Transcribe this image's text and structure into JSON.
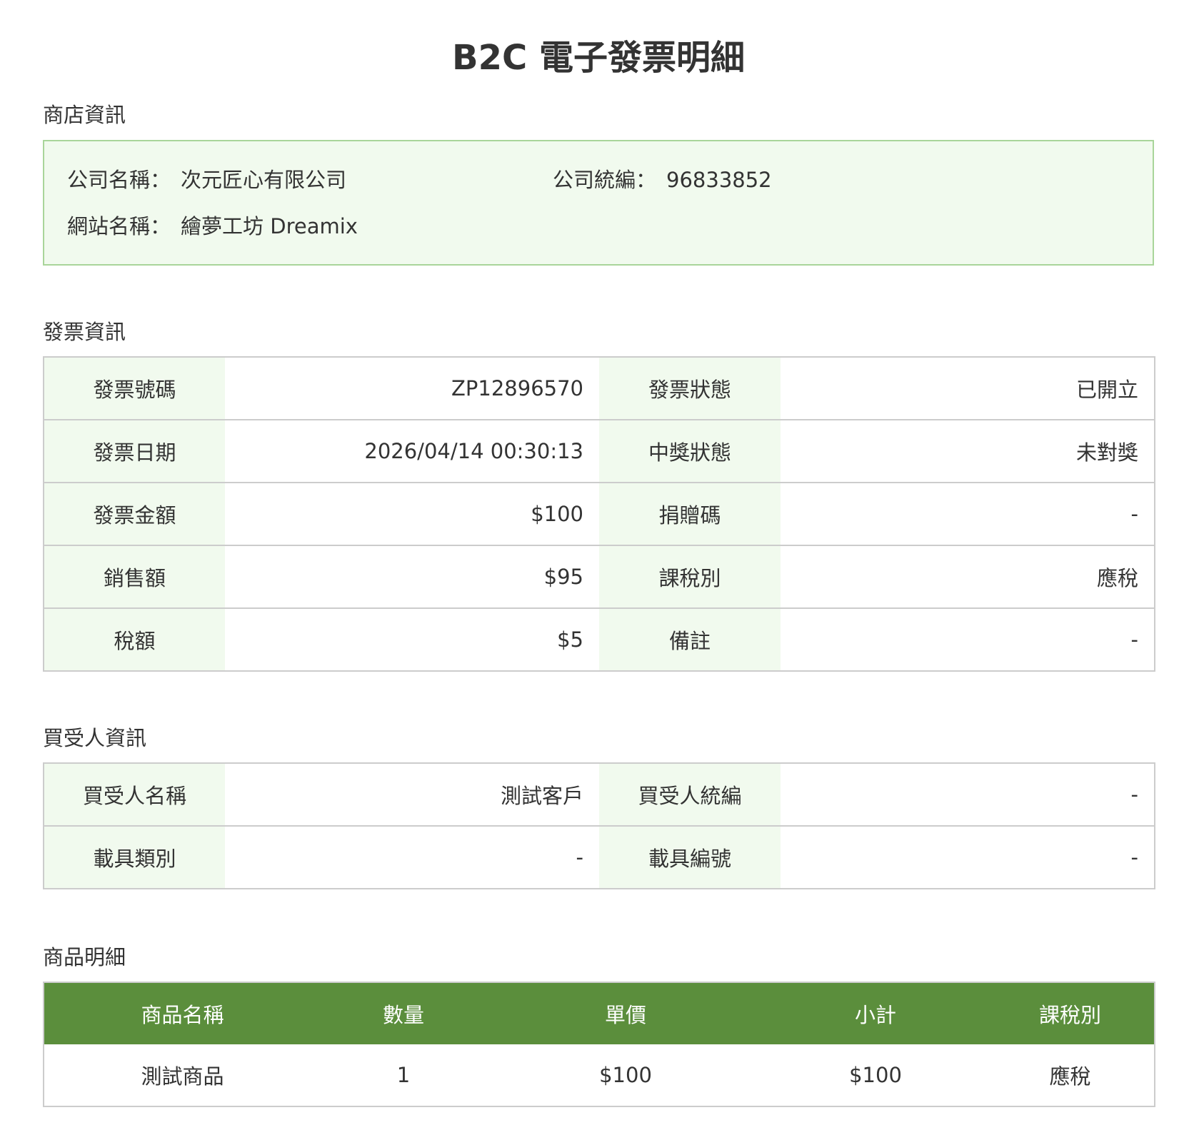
{
  "title": "B2C 電子發票明細",
  "store": {
    "section_title": "商店資訊",
    "company_name_label": "公司名稱：",
    "company_name": "次元匠心有限公司",
    "tax_id_label": "公司統編：",
    "tax_id": "96833852",
    "site_name_label": "網站名稱：",
    "site_name": "繪夢工坊 Dreamix"
  },
  "invoice": {
    "section_title": "發票資訊",
    "rows": [
      {
        "k1": "發票號碼",
        "v1": "ZP12896570",
        "k2": "發票狀態",
        "v2": "已開立"
      },
      {
        "k1": "發票日期",
        "v1": "2026/04/14 00:30:13",
        "k2": "中獎狀態",
        "v2": "未對獎"
      },
      {
        "k1": "發票金額",
        "v1": "$100",
        "k2": "捐贈碼",
        "v2": "-"
      },
      {
        "k1": "銷售額",
        "v1": "$95",
        "k2": "課稅別",
        "v2": "應稅"
      },
      {
        "k1": "稅額",
        "v1": "$5",
        "k2": "備註",
        "v2": "-"
      }
    ]
  },
  "buyer": {
    "section_title": "買受人資訊",
    "rows": [
      {
        "k1": "買受人名稱",
        "v1": "測試客戶",
        "k2": "買受人統編",
        "v2": "-"
      },
      {
        "k1": "載具類別",
        "v1": "-",
        "k2": "載具編號",
        "v2": "-"
      }
    ]
  },
  "items": {
    "section_title": "商品明細",
    "headers": [
      "商品名稱",
      "數量",
      "單價",
      "小計",
      "課稅別"
    ],
    "rows": [
      [
        "測試商品",
        "1",
        "$100",
        "$100",
        "應稅"
      ]
    ]
  },
  "colors": {
    "header_green": "#5b8e3c",
    "light_green": "#f1faee",
    "border_green": "#a9d59a",
    "border_gray": "#cccccc",
    "text": "#333333"
  }
}
